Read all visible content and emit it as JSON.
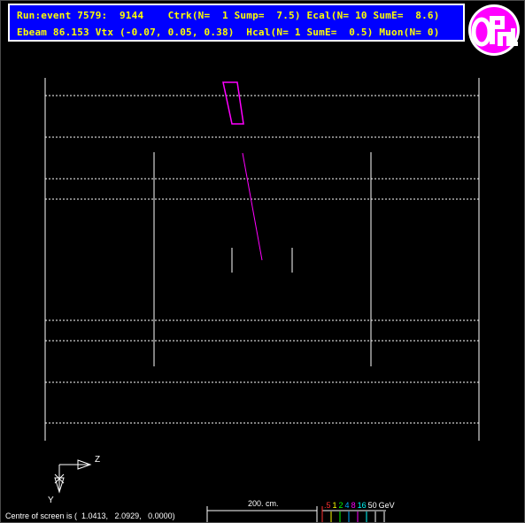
{
  "header": {
    "line1": "Run:event 7579:  9144    Ctrk(N=  1 Sump=  7.5) Ecal(N= 10 SumE=  8.6)",
    "line2": "Ebeam 86.153 Vtx (-0.07, 0.05, 0.38)  Hcal(N= 1 SumE=  0.5) Muon(N= 0)"
  },
  "logo": {
    "text": "OPAL",
    "color": "#ff00ff"
  },
  "axes": {
    "z_label": "Z",
    "y_label": "Y"
  },
  "footer": {
    "centre_text": "Centre of screen is (  1.0413,   2.0929,   0.0000)",
    "scale_label": "200. cm.",
    "energy_scale": [
      {
        "text": ".5",
        "color": "#ff3030"
      },
      {
        "text": "1",
        "color": "#ffff00"
      },
      {
        "text": "2",
        "color": "#00ff00"
      },
      {
        "text": "4",
        "color": "#00aaff"
      },
      {
        "text": "8",
        "color": "#ff00ff"
      },
      {
        "text": "16",
        "color": "#00ffff"
      },
      {
        "text": "50",
        "color": "#ffffff"
      },
      {
        "text": "GeV",
        "color": "#ffffff"
      }
    ]
  },
  "colors": {
    "detector": "#ffffff",
    "track": "#ff00ff",
    "background": "#000000"
  }
}
